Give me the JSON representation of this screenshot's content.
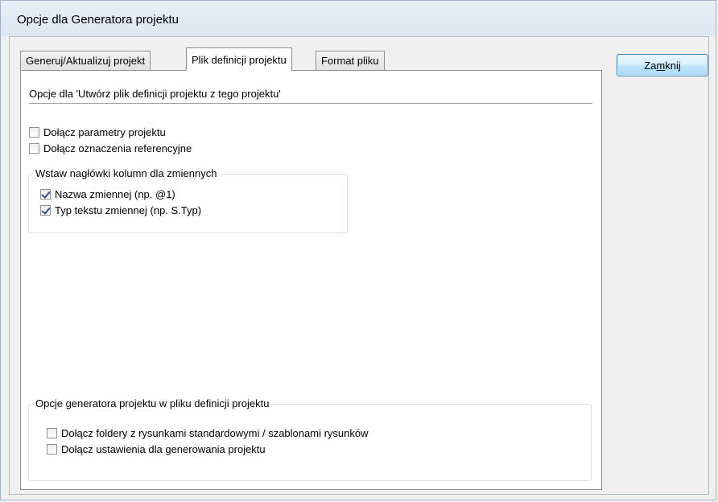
{
  "window": {
    "title": "Opcje dla Generatora projektu"
  },
  "tabs": [
    {
      "label": "Generuj/Aktualizuj projekt",
      "active": false
    },
    {
      "label": "Plik definicji projektu",
      "active": true
    },
    {
      "label": "Format pliku",
      "active": false
    }
  ],
  "close_button": {
    "label_pre": "Za",
    "label_accel": "m",
    "label_post": "knij"
  },
  "panel": {
    "heading": "Opcje dla 'Utwórz plik definicji projektu z tego projektu'",
    "checkboxes": [
      {
        "label": "Dołącz parametry projektu",
        "checked": false
      },
      {
        "label": "Dołącz oznaczenia referencyjne",
        "checked": false
      }
    ],
    "column_headers_group": {
      "title": "Wstaw nagłówki kolumn dla zmiennych",
      "items": [
        {
          "label": "Nazwa zmiennej (np. @1)",
          "checked": true
        },
        {
          "label": "Typ tekstu zmiennej (np. S.Typ)",
          "checked": true
        }
      ]
    },
    "generator_group": {
      "title": "Opcje generatora projektu w pliku definicji projektu",
      "items": [
        {
          "label": "Dołącz foldery z rysunkami standardowymi / szablonami rysunków",
          "checked": false
        },
        {
          "label": "Dołącz ustawienia dla generowania projektu",
          "checked": false
        }
      ]
    }
  }
}
